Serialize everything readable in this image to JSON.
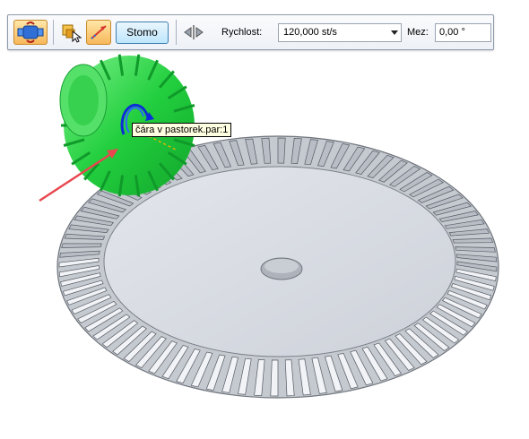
{
  "toolbar": {
    "stop_label": "Stomo",
    "speed_label": "Rychlost:",
    "speed_value": "120,000 st/s",
    "limit_label": "Mez:",
    "limit_value": "0,00 °",
    "icons": {
      "motor": "motor-icon",
      "select_part": "select-part-icon",
      "direction": "direction-icon",
      "flip": "flip-direction-icon"
    }
  },
  "viewport": {
    "tooltip": "čára v pastorek.par:1",
    "pinion_color": "#2fd44a",
    "gear_color": "#d7dbe2",
    "arrow_color": "#e8474f"
  }
}
